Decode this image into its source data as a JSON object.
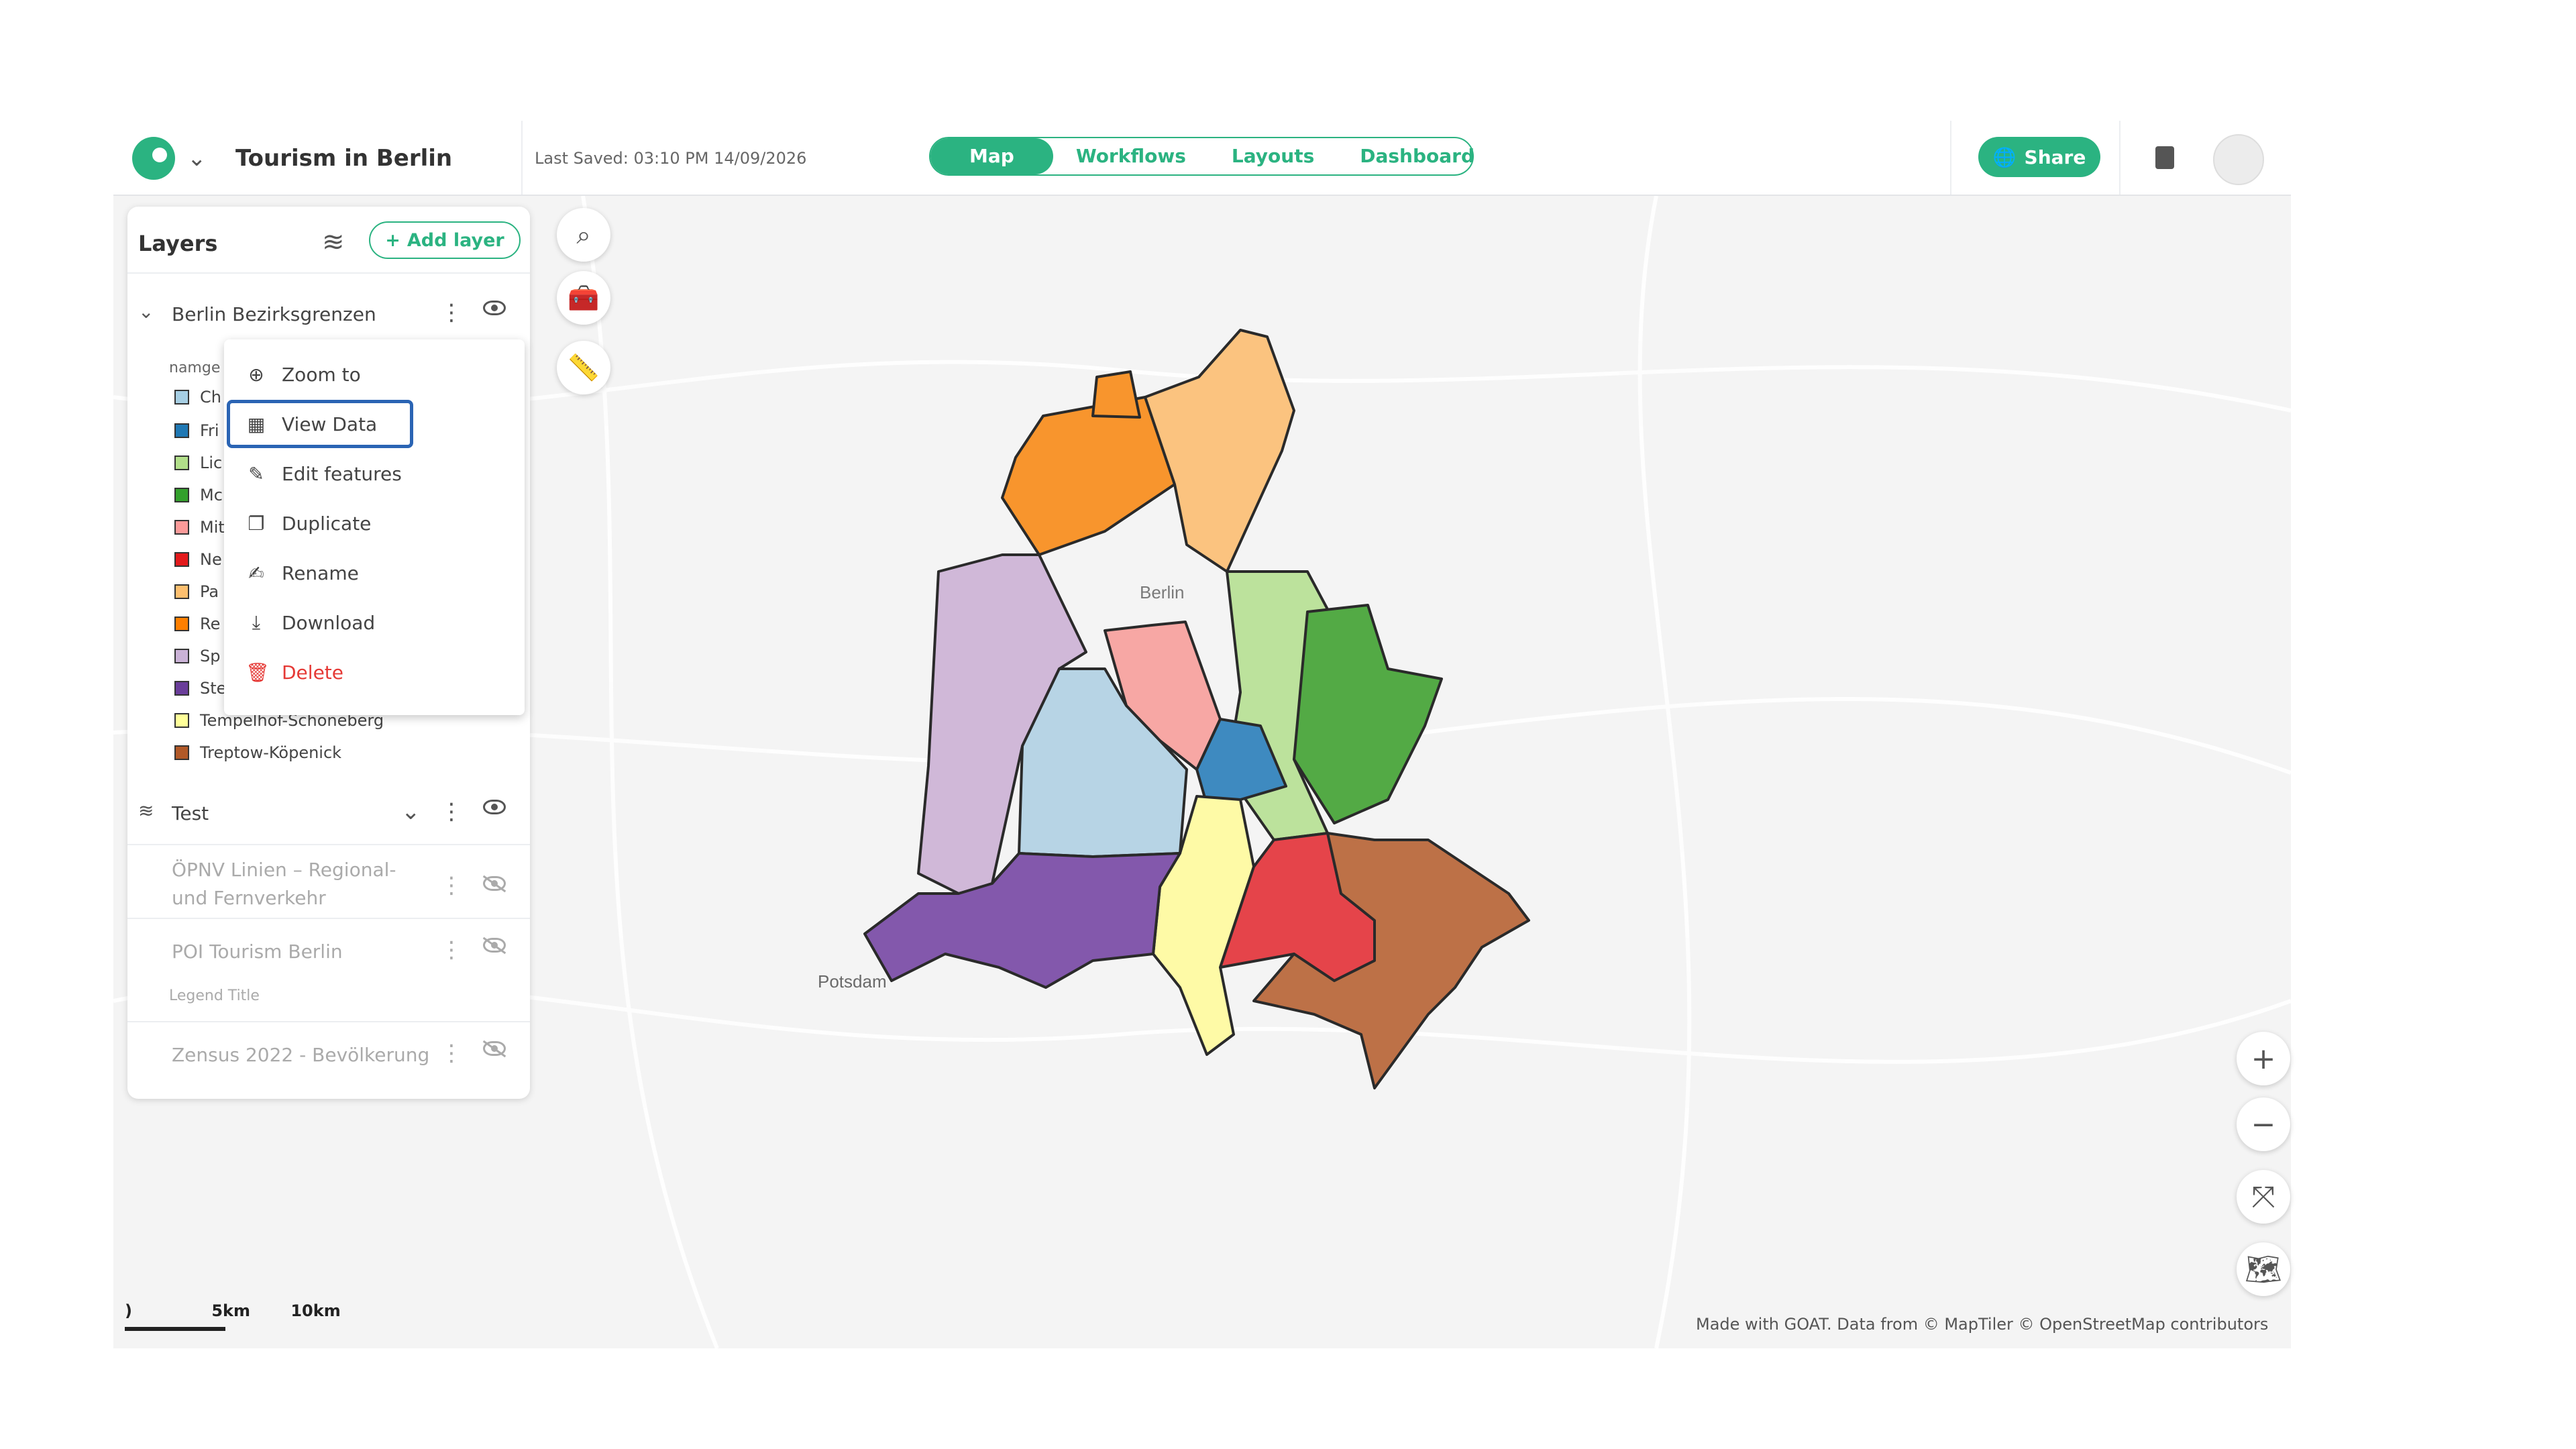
{
  "header": {
    "project_title": "Tourism in Berlin",
    "last_saved": "Last Saved: 03:10 PM 14/09/2026",
    "tabs": [
      {
        "label": "Map",
        "active": true
      },
      {
        "label": "Workflows",
        "active": false
      },
      {
        "label": "Layouts",
        "active": false
      },
      {
        "label": "Dashboard",
        "active": false
      }
    ],
    "share_label": "Share"
  },
  "layers_panel": {
    "title": "Layers",
    "add_layer_label": "Add layer",
    "layer_main": {
      "name": "Berlin Bezirksgrenzen",
      "legend_heading": "namge"
    },
    "legend": [
      {
        "label": "Ch",
        "color": "#a6cee3"
      },
      {
        "label": "Fri",
        "color": "#1f78b4"
      },
      {
        "label": "Lic",
        "color": "#b2df8a"
      },
      {
        "label": "Mc",
        "color": "#33a02c"
      },
      {
        "label": "Mit",
        "color": "#fb9a99"
      },
      {
        "label": "Ne",
        "color": "#e31a1c"
      },
      {
        "label": "Pa",
        "color": "#fdbf6f"
      },
      {
        "label": "Re",
        "color": "#ff7f00"
      },
      {
        "label": "Sp",
        "color": "#cab2d6"
      },
      {
        "label": "Ste",
        "color": "#6a3d9a"
      },
      {
        "label": "Tempelhof-Schöneberg",
        "color": "#ffff99"
      },
      {
        "label": "Treptow-Köpenick",
        "color": "#b15928"
      }
    ],
    "group": {
      "name": "Test"
    },
    "sub_layers": [
      {
        "name": "ÖPNV Linien – Regional- und Fernverkehr"
      },
      {
        "name": "POI Tourism Berlin",
        "note": "Legend Title"
      },
      {
        "name": "Zensus 2022 - Bevölkerung"
      }
    ]
  },
  "context_menu": {
    "items": [
      {
        "label": "Zoom to",
        "icon": "zoom-in-icon"
      },
      {
        "label": "View Data",
        "icon": "table-icon"
      },
      {
        "label": "Edit features",
        "icon": "pencil-icon"
      },
      {
        "label": "Duplicate",
        "icon": "copy-icon"
      },
      {
        "label": "Rename",
        "icon": "edit-icon"
      },
      {
        "label": "Download",
        "icon": "download-icon"
      },
      {
        "label": "Delete",
        "icon": "trash-icon"
      }
    ]
  },
  "map": {
    "place_labels": [
      "Berlin",
      "Potsdam"
    ],
    "scale": {
      "left": ")",
      "mid": "5km",
      "right": "10km"
    },
    "attribution": "Made with GOAT. Data from © MapTiler © OpenStreetMap contributors"
  }
}
